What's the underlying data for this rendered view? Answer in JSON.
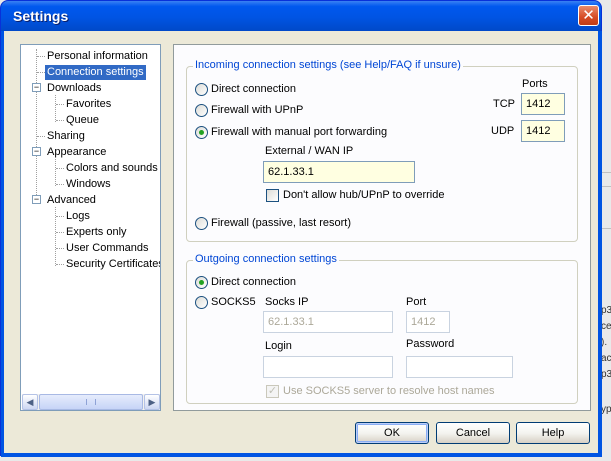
{
  "window": {
    "title": "Settings"
  },
  "background_text": [
    "p3",
    "ce",
    ").",
    "ac",
    "p3",
    "yp"
  ],
  "tree": {
    "items": [
      {
        "label": "Personal information"
      },
      {
        "label": "Connection settings",
        "selected": true
      },
      {
        "label": "Downloads",
        "expander": "−"
      },
      {
        "label": "Favorites"
      },
      {
        "label": "Queue"
      },
      {
        "label": "Sharing"
      },
      {
        "label": "Appearance",
        "expander": "−"
      },
      {
        "label": "Colors and sounds"
      },
      {
        "label": "Windows"
      },
      {
        "label": "Advanced",
        "expander": "−"
      },
      {
        "label": "Logs"
      },
      {
        "label": "Experts only"
      },
      {
        "label": "User Commands"
      },
      {
        "label": "Security Certificates"
      }
    ],
    "scroll_left": "◀",
    "scroll_right": "▶"
  },
  "incoming": {
    "legend": "Incoming connection settings (see Help/FAQ if unsure)",
    "direct_label": "Direct connection",
    "upnp_label": "Firewall with UPnP",
    "manual_label": "Firewall with manual port forwarding",
    "passive_label": "Firewall (passive, last resort)",
    "selected": "Firewall with manual port forwarding",
    "ports_label": "Ports",
    "tcp_label": "TCP",
    "tcp_value": "1412",
    "udp_label": "UDP",
    "udp_value": "1412",
    "wan_label": "External / WAN IP",
    "wan_value": "62.1.33.1",
    "override_label": "Don't allow hub/UPnP to override",
    "override_checked": false
  },
  "outgoing": {
    "legend": "Outgoing connection settings",
    "direct_label": "Direct connection",
    "socks_label": "SOCKS5",
    "selected": "Direct connection",
    "socks_ip_label": "Socks IP",
    "socks_ip_value": "62.1.33.1",
    "port_label": "Port",
    "port_value": "1412",
    "login_label": "Login",
    "login_value": "",
    "password_label": "Password",
    "password_value": "",
    "resolve_label": "Use SOCKS5 server to resolve host names",
    "resolve_checked": true
  },
  "buttons": {
    "ok": "OK",
    "cancel": "Cancel",
    "help": "Help"
  },
  "glyphs": {
    "close": "✕",
    "check": "✓"
  }
}
